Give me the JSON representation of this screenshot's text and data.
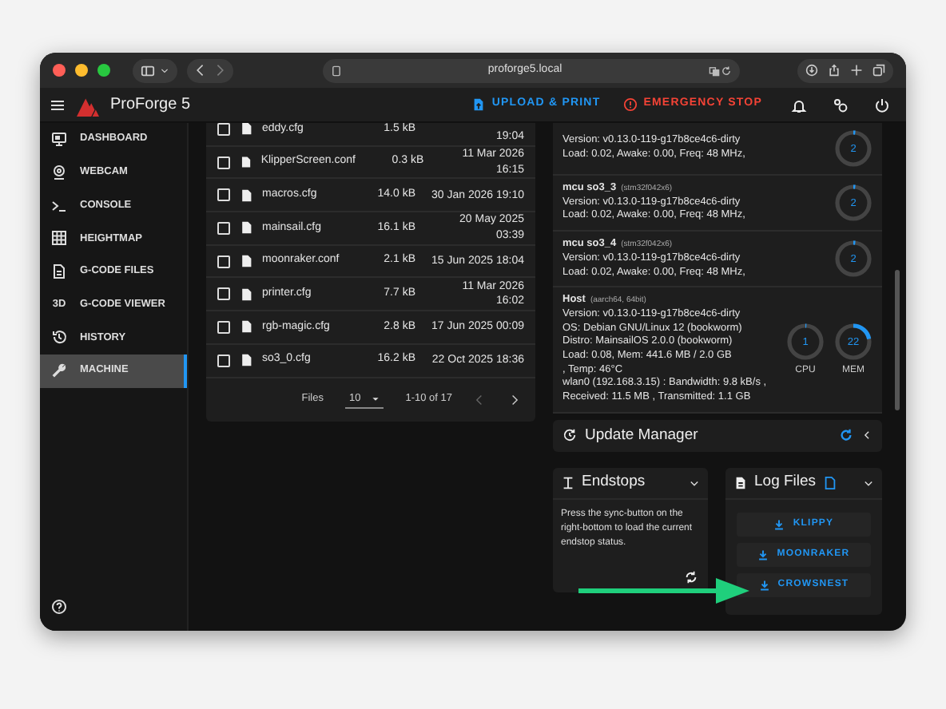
{
  "browser": {
    "url": "proforge5.local"
  },
  "app_bar": {
    "title": "ProForge 5",
    "actions": [
      {
        "kind": "upload",
        "label": "UPLOAD & PRINT"
      },
      {
        "kind": "stop",
        "label": "EMERGENCY STOP"
      }
    ]
  },
  "sidebar": {
    "items": [
      {
        "kind": "dashboard",
        "label": "DASHBOARD",
        "selected": false
      },
      {
        "kind": "webcam",
        "label": "WEBCAM",
        "selected": false
      },
      {
        "kind": "console",
        "label": "CONSOLE",
        "selected": false
      },
      {
        "kind": "heightmap",
        "label": "HEIGHTMAP",
        "selected": false
      },
      {
        "kind": "files",
        "label": "G-CODE FILES",
        "selected": false
      },
      {
        "kind": "viewer",
        "label": "G-CODE VIEWER",
        "icon_text": "3D",
        "selected": false
      },
      {
        "kind": "history",
        "label": "HISTORY",
        "selected": false
      },
      {
        "kind": "machine",
        "label": "MACHINE",
        "selected": true
      }
    ]
  },
  "files": {
    "rows": [
      {
        "name": "eddy.cfg",
        "size": "1.5 kB",
        "time": "19:04",
        "checked": false
      },
      {
        "name": "KlipperScreen.conf",
        "size": "0.3 kB",
        "date": "11 Mar 2026",
        "time": "16:15",
        "checked": false
      },
      {
        "name": "macros.cfg",
        "size": "14.0 kB",
        "date": "30 Jan 2026 19:10",
        "checked": false
      },
      {
        "name": "mainsail.cfg",
        "size": "16.1 kB",
        "date": "20 May 2025",
        "time": "03:39",
        "checked": false
      },
      {
        "name": "moonraker.conf",
        "size": "2.1 kB",
        "date": "15 Jun 2025 18:04",
        "checked": false
      },
      {
        "name": "printer.cfg",
        "size": "7.7 kB",
        "date": "11 Mar 2026",
        "time": "16:02",
        "checked": false
      },
      {
        "name": "rgb-magic.cfg",
        "size": "2.8 kB",
        "date": "17 Jun 2025 00:09",
        "checked": false
      },
      {
        "name": "so3_0.cfg",
        "size": "16.2 kB",
        "date": "22 Oct 2025 18:36",
        "checked": false
      }
    ],
    "footer": {
      "label": "Files",
      "per_page": "10",
      "range": "1-10 of 17"
    }
  },
  "system": {
    "entries": [
      {
        "lines": [
          "Version: v0.13.0-119-g17b8ce4c6-dirty",
          "Load: 0.02, Awake: 0.00, Freq: 48 MHz,"
        ],
        "gauges": [
          {
            "value": "2",
            "level": 0.02
          }
        ]
      },
      {
        "name": "mcu so3_3",
        "chip": "(stm32f042x6)",
        "lines": [
          "Version: v0.13.0-119-g17b8ce4c6-dirty",
          "Load: 0.02, Awake: 0.00, Freq: 48 MHz,"
        ],
        "gauges": [
          {
            "value": "2",
            "level": 0.02
          }
        ]
      },
      {
        "name": "mcu so3_4",
        "chip": "(stm32f042x6)",
        "lines": [
          "Version: v0.13.0-119-g17b8ce4c6-dirty",
          "Load: 0.02, Awake: 0.00, Freq: 48 MHz,"
        ],
        "gauges": [
          {
            "value": "2",
            "level": 0.02
          }
        ]
      },
      {
        "name": "Host",
        "chip": "(aarch64, 64bit)",
        "lines": [
          "Version: v0.13.0-119-g17b8ce4c6-dirty",
          "OS: Debian GNU/Linux 12 (bookworm)",
          "Distro: MainsailOS 2.0.0 (bookworm)",
          "Load: 0.08, Mem: 441.6 MB / 2.0 GB",
          ", Temp: 46°C",
          "wlan0 (192.168.3.15) : Bandwidth: 9.8 kB/s ,",
          "Received: 11.5 MB , Transmitted: 1.1 GB"
        ],
        "gauges": [
          {
            "value": "1",
            "level": 0.01,
            "label": "CPU"
          },
          {
            "value": "22",
            "level": 0.22,
            "label": "MEM"
          }
        ]
      }
    ]
  },
  "update_manager": {
    "title": "Update Manager"
  },
  "endstops": {
    "title": "Endstops",
    "text": "Press the sync-button on the right-bottom to load the current endstop status."
  },
  "log_files": {
    "title": "Log Files",
    "buttons": [
      "KLIPPY",
      "MOONRAKER",
      "CROWSNEST"
    ]
  }
}
